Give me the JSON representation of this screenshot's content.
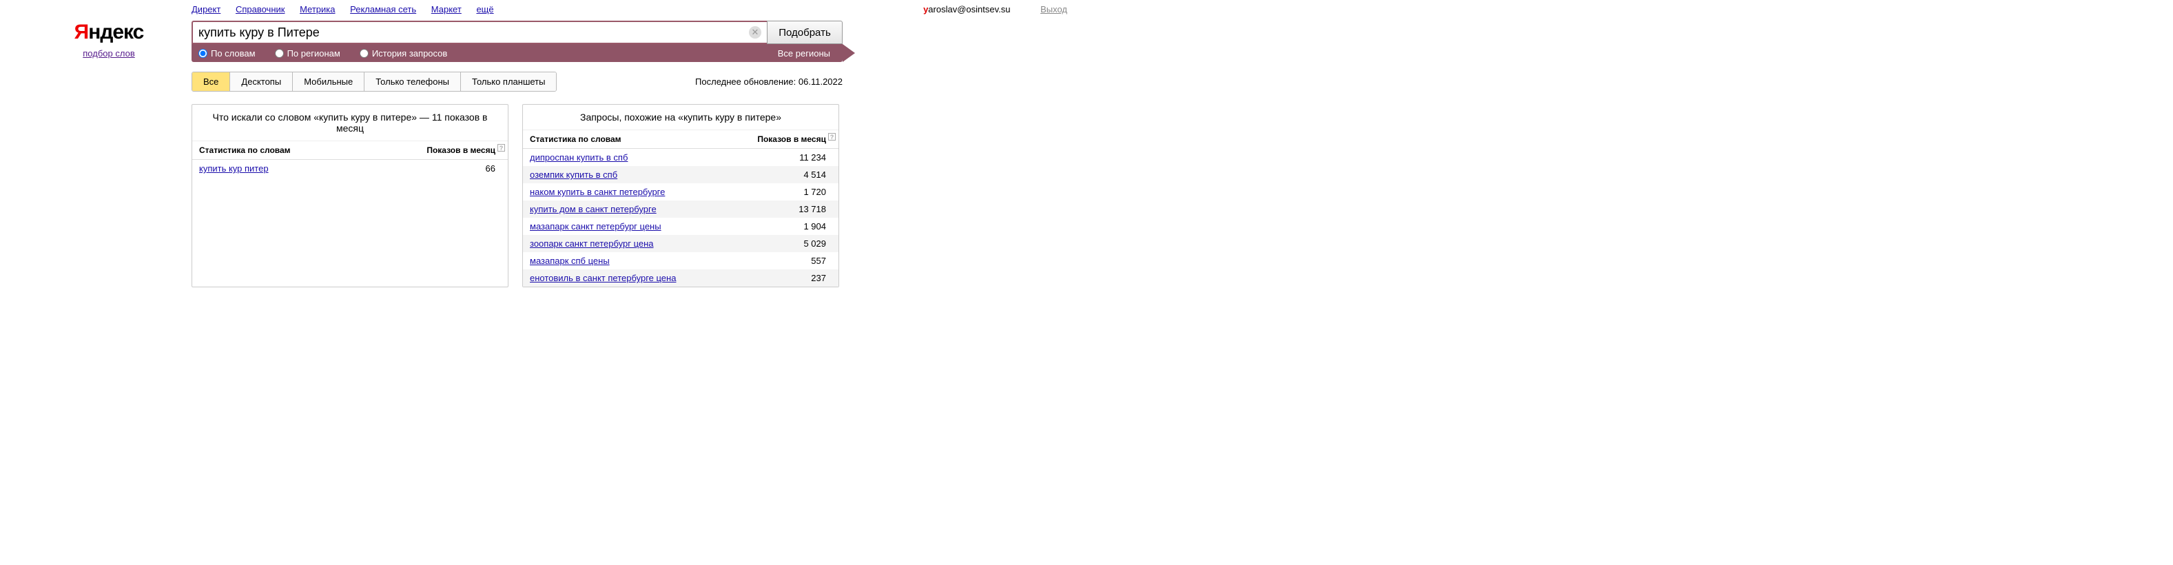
{
  "topnav": [
    "Директ",
    "Справочник",
    "Метрика",
    "Рекламная сеть",
    "Маркет",
    "ещё"
  ],
  "user": {
    "login_rest": "aroslav@osintsev.su",
    "logout": "Выход"
  },
  "logo": {
    "brand_rest": "ндекс",
    "subtitle": "подбор слов"
  },
  "search": {
    "value": "купить куру в Питере",
    "button": "Подобрать",
    "radios": [
      "По словам",
      "По регионам",
      "История запросов"
    ],
    "regions": "Все регионы"
  },
  "device_tabs": [
    "Все",
    "Десктопы",
    "Мобильные",
    "Только телефоны",
    "Только планшеты"
  ],
  "last_update_label": "Последнее обновление: 06.11.2022",
  "left_panel": {
    "title": "Что искали со словом «купить куру в питере» — 11 показов в месяц",
    "col_stat": "Статистика по словам",
    "col_cnt": "Показов в месяц",
    "rows": [
      {
        "q": "купить кур питер",
        "n": "66"
      }
    ]
  },
  "right_panel": {
    "title": "Запросы, похожие на «купить куру в питере»",
    "col_stat": "Статистика по словам",
    "col_cnt": "Показов в месяц",
    "rows": [
      {
        "q": "дипроспан купить в спб",
        "n": "11 234"
      },
      {
        "q": "оземпик купить в спб",
        "n": "4 514"
      },
      {
        "q": "наком купить в санкт петербурге",
        "n": "1 720"
      },
      {
        "q": "купить дом в санкт петербурге",
        "n": "13 718"
      },
      {
        "q": "мазапарк санкт петербург цены",
        "n": "1 904"
      },
      {
        "q": "зоопарк санкт петербург цена",
        "n": "5 029"
      },
      {
        "q": "мазапарк спб цены",
        "n": "557"
      },
      {
        "q": "енотовиль в санкт петербурге цена",
        "n": "237"
      }
    ]
  }
}
